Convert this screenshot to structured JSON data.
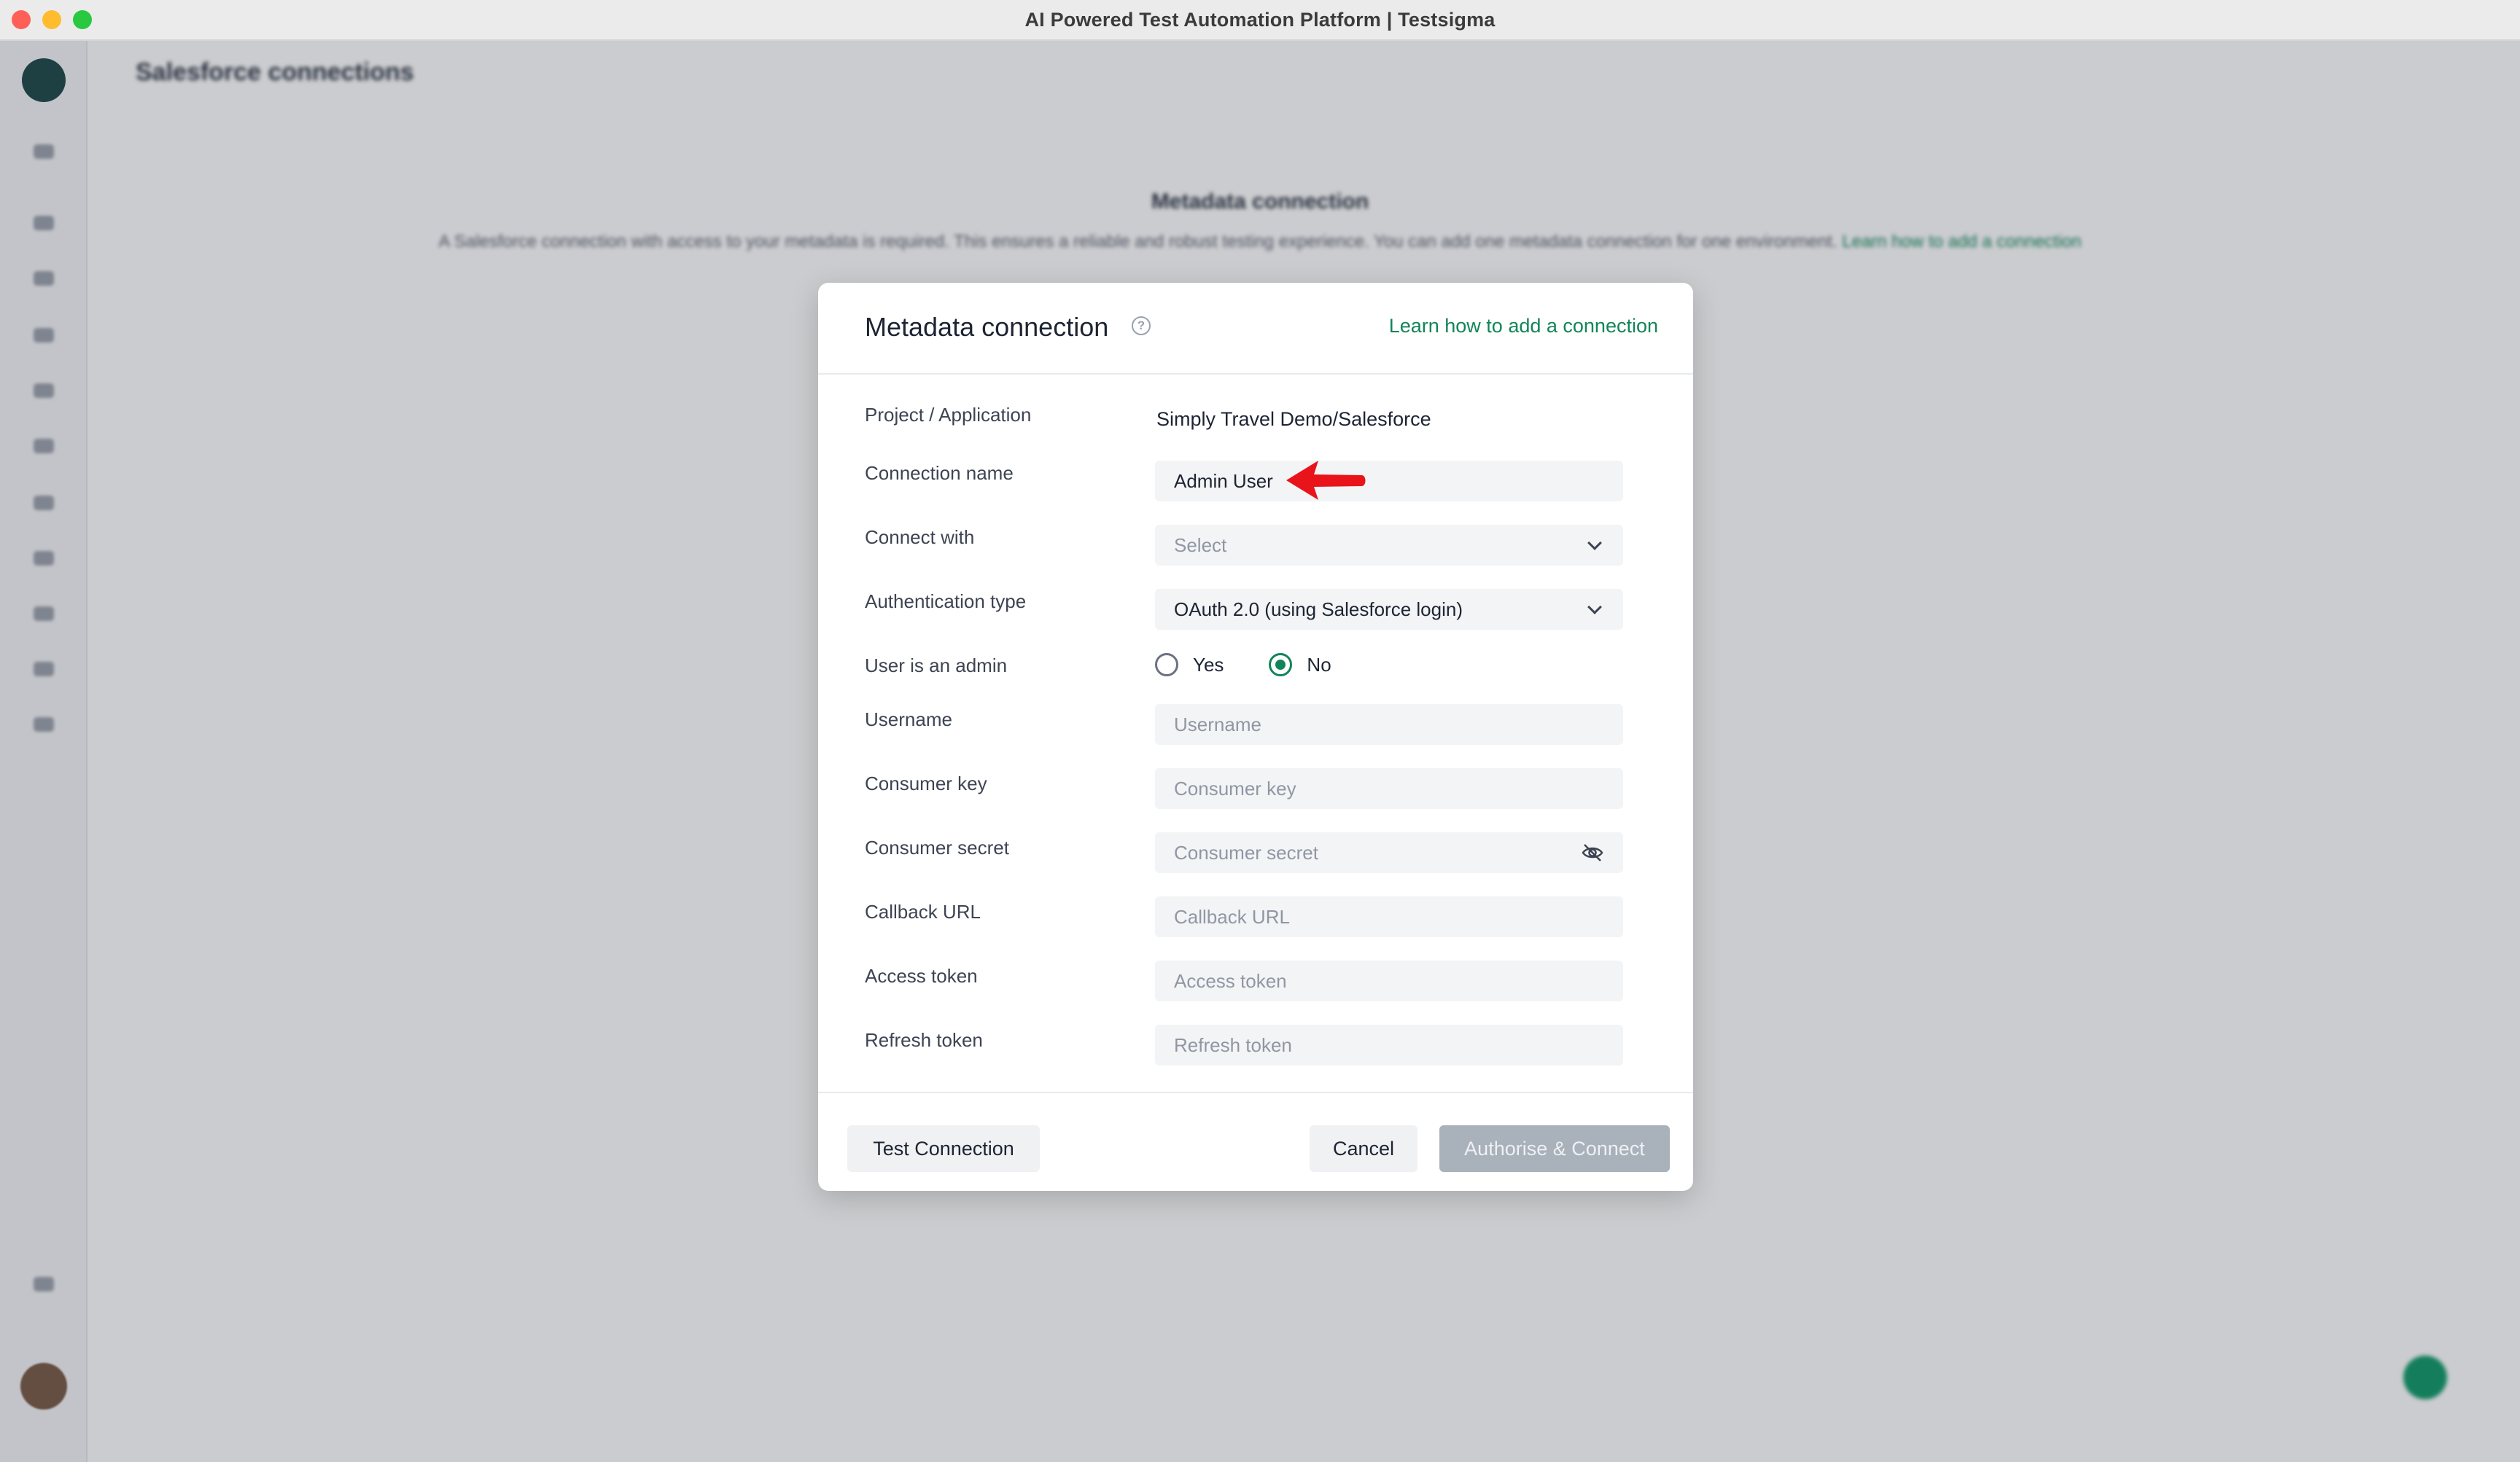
{
  "window": {
    "title": "AI Powered Test Automation Platform | Testsigma"
  },
  "background": {
    "heading": "Salesforce connections",
    "section_title": "Metadata connection",
    "section_desc": "A Salesforce connection with access to your metadata is required. This ensures a reliable and robust testing experience. You can add one metadata connection for one environment.",
    "section_link": "Learn how to add a connection"
  },
  "modal": {
    "title": "Metadata connection",
    "help_icon": "question-circle-icon",
    "learn_link": "Learn how to add a connection",
    "fields": {
      "project": {
        "label": "Project / Application",
        "value": "Simply Travel Demo/Salesforce"
      },
      "connection_name": {
        "label": "Connection name",
        "value": "Admin User"
      },
      "connect_with": {
        "label": "Connect with",
        "value": "Select"
      },
      "auth_type": {
        "label": "Authentication type",
        "value": "OAuth 2.0 (using Salesforce login)"
      },
      "user_is_admin": {
        "label": "User is an admin",
        "options": [
          "Yes",
          "No"
        ],
        "selected": "No"
      },
      "username": {
        "label": "Username",
        "placeholder": "Username"
      },
      "consumer_key": {
        "label": "Consumer key",
        "placeholder": "Consumer key"
      },
      "consumer_secret": {
        "label": "Consumer secret",
        "placeholder": "Consumer secret",
        "icon": "eye-off-icon"
      },
      "callback_url": {
        "label": "Callback URL",
        "placeholder": "Callback URL"
      },
      "access_token": {
        "label": "Access token",
        "placeholder": "Access token"
      },
      "refresh_token": {
        "label": "Refresh token",
        "placeholder": "Refresh token"
      }
    },
    "footer": {
      "test_label": "Test Connection",
      "cancel_label": "Cancel",
      "authorise_label": "Authorise & Connect"
    }
  },
  "colors": {
    "accent": "#11855a",
    "annotation_arrow": "#e8141a",
    "disabled_button": "#a9b1ba"
  }
}
